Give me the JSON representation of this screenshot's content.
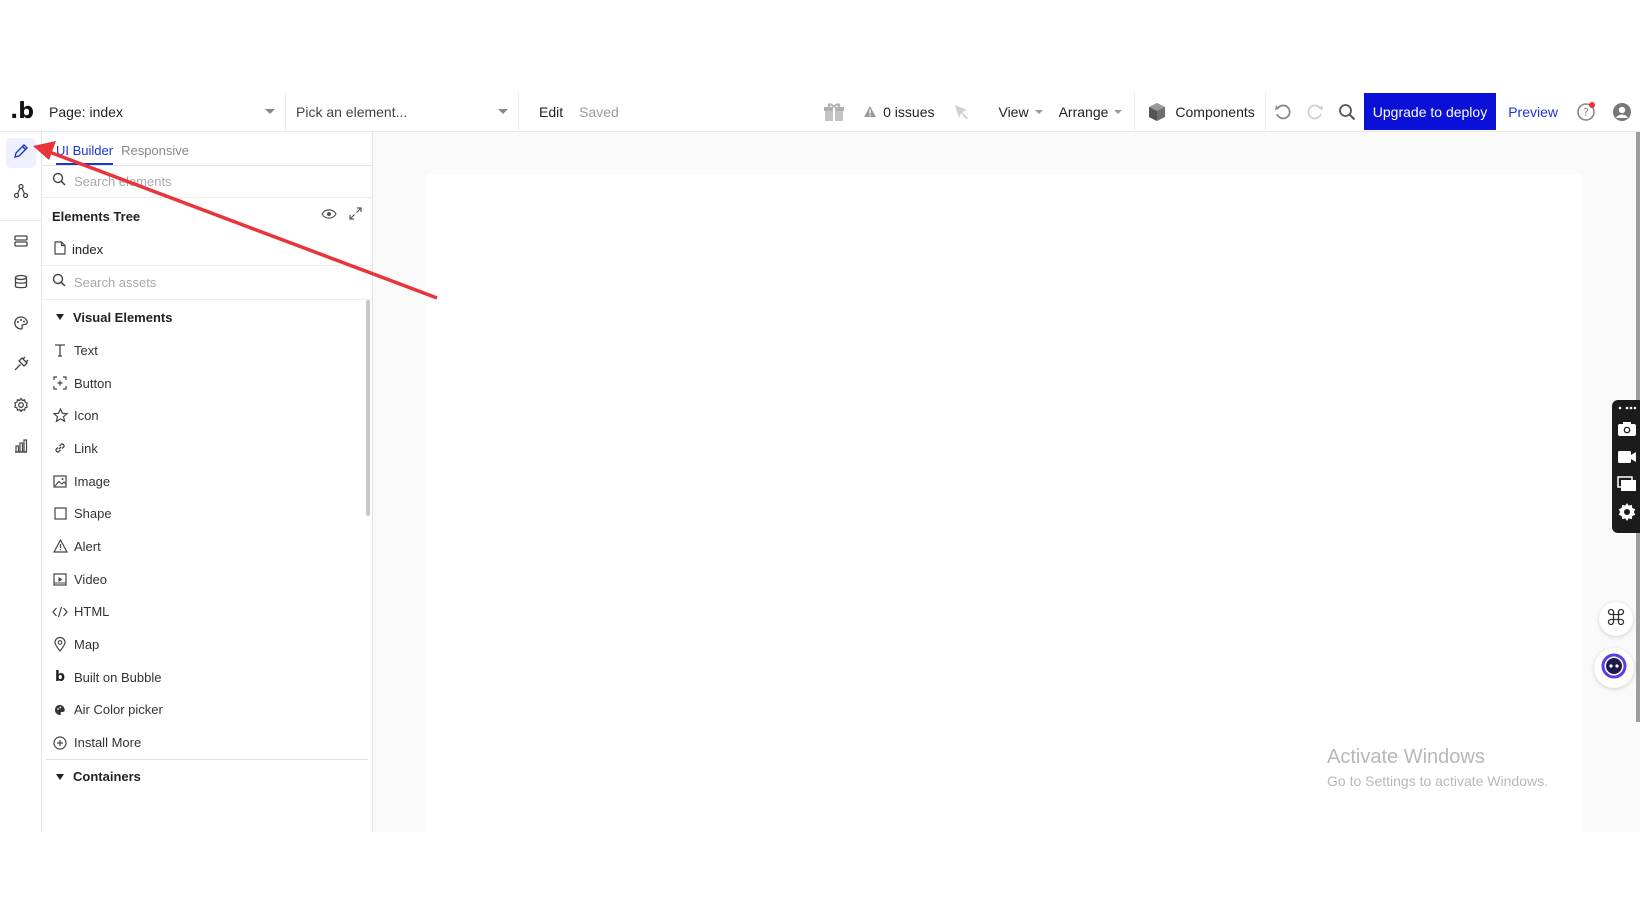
{
  "topbar": {
    "logo": ".b",
    "page_select": "Page: index",
    "element_select_placeholder": "Pick an element...",
    "edit_label": "Edit",
    "saved_label": "Saved",
    "issues": "0 issues",
    "view": "View",
    "arrange": "Arrange",
    "components": "Components",
    "upgrade": "Upgrade to deploy",
    "preview": "Preview"
  },
  "rail": {
    "items": [
      "pencil-icon",
      "workflow-icon",
      "data-icon",
      "database-icon",
      "palette-icon",
      "plugin-icon",
      "settings-icon",
      "analytics-icon"
    ]
  },
  "panel": {
    "tabs": [
      "UI Builder",
      "Responsive"
    ],
    "search_elements_placeholder": "Search elements",
    "elements_tree_title": "Elements Tree",
    "tree_root": "index",
    "search_assets_placeholder": "Search assets",
    "visual_elements_title": "Visual Elements",
    "visual_elements": [
      {
        "label": "Text",
        "icon": "text-icon"
      },
      {
        "label": "Button",
        "icon": "button-icon"
      },
      {
        "label": "Icon",
        "icon": "star-icon"
      },
      {
        "label": "Link",
        "icon": "link-icon"
      },
      {
        "label": "Image",
        "icon": "image-icon"
      },
      {
        "label": "Shape",
        "icon": "square-icon"
      },
      {
        "label": "Alert",
        "icon": "warning-icon"
      },
      {
        "label": "Video",
        "icon": "video-icon"
      },
      {
        "label": "HTML",
        "icon": "code-icon"
      },
      {
        "label": "Map",
        "icon": "map-pin-icon"
      },
      {
        "label": "Built on Bubble",
        "icon": "bubble-icon"
      },
      {
        "label": "Air Color picker",
        "icon": "palette-icon"
      },
      {
        "label": "Install More",
        "icon": "plus-circle-icon"
      }
    ],
    "containers_title": "Containers"
  },
  "watermark": {
    "line1": "Activate Windows",
    "line2": "Go to Settings to activate Windows."
  },
  "colors": {
    "accent": "#1a35d8",
    "upgrade_bg": "#0b10d8",
    "annotation_arrow": "#e8353a"
  }
}
